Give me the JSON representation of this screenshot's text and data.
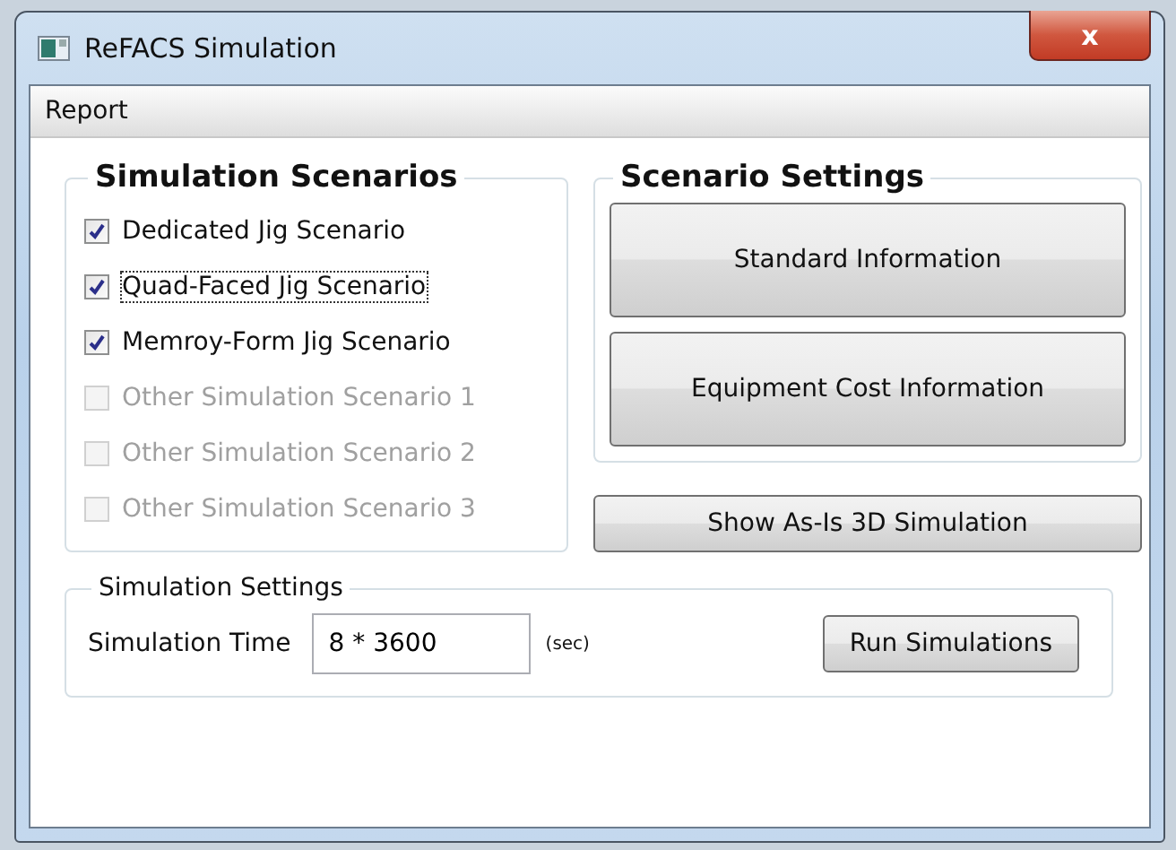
{
  "window": {
    "title": "ReFACS Simulation",
    "close_label": "x"
  },
  "menu": [
    {
      "label": "Report"
    }
  ],
  "simulation_scenarios": {
    "title": "Simulation Scenarios",
    "items": [
      {
        "label": "Dedicated Jig Scenario",
        "checked": true,
        "disabled": false,
        "focused": false
      },
      {
        "label": "Quad-Faced Jig Scenario",
        "checked": true,
        "disabled": false,
        "focused": true
      },
      {
        "label": "Memroy-Form Jig Scenario",
        "checked": true,
        "disabled": false,
        "focused": false
      },
      {
        "label": "Other Simulation Scenario 1",
        "checked": false,
        "disabled": true,
        "focused": false
      },
      {
        "label": "Other Simulation Scenario 2",
        "checked": false,
        "disabled": true,
        "focused": false
      },
      {
        "label": "Other Simulation Scenario 3",
        "checked": false,
        "disabled": true,
        "focused": false
      }
    ]
  },
  "scenario_settings": {
    "title": "Scenario Settings",
    "buttons": [
      "Standard Information",
      "Equipment Cost Information"
    ]
  },
  "show_button": "Show As-Is 3D Simulation",
  "simulation_settings": {
    "title": "Simulation Settings",
    "time_label": "Simulation Time",
    "time_value": "8 * 3600",
    "unit": "(sec)",
    "run_button": "Run Simulations"
  }
}
